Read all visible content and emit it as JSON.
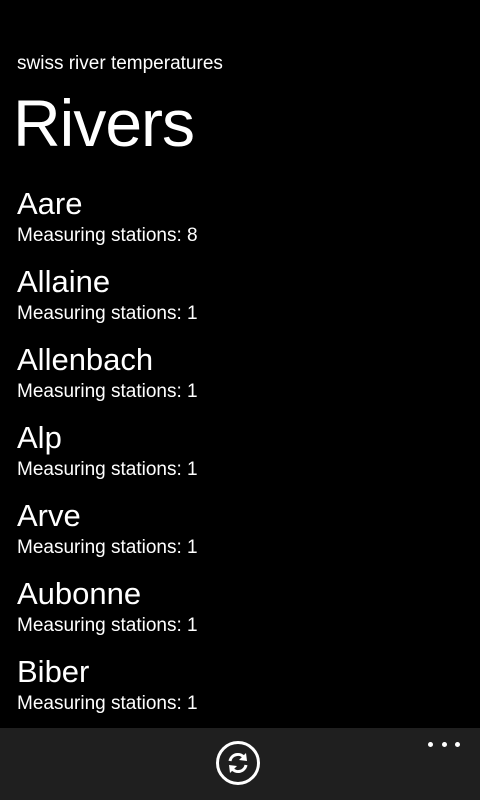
{
  "header": {
    "app_title": "swiss river temperatures",
    "page_title": "Rivers"
  },
  "rivers": [
    {
      "name": "Aare",
      "stations": "Measuring stations: 8"
    },
    {
      "name": "Allaine",
      "stations": "Measuring stations: 1"
    },
    {
      "name": "Allenbach",
      "stations": "Measuring stations: 1"
    },
    {
      "name": "Alp",
      "stations": "Measuring stations: 1"
    },
    {
      "name": "Arve",
      "stations": "Measuring stations: 1"
    },
    {
      "name": "Aubonne",
      "stations": "Measuring stations: 1"
    },
    {
      "name": "Biber",
      "stations": "Measuring stations: 1"
    }
  ],
  "app_bar": {
    "refresh_icon": "refresh-icon",
    "more_icon": "ellipsis-icon",
    "background_color": "#1f1f1f"
  }
}
